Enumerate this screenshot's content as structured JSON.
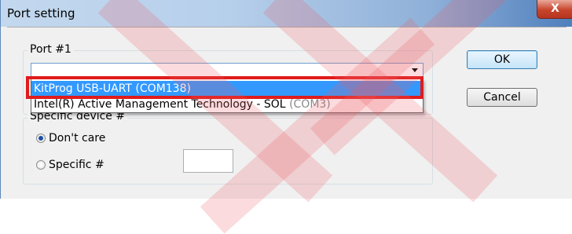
{
  "window": {
    "title": "Port setting",
    "close_glyph": "X"
  },
  "port_group": {
    "legend": "Port #1",
    "combo_value": "",
    "options": [
      {
        "label": "KitProg USB-UART (COM138)",
        "selected": true,
        "extra": ""
      },
      {
        "label": "Intel(R) Active Management Technology - SOL ",
        "selected": false,
        "extra": "(COM3)"
      }
    ]
  },
  "device_group": {
    "legend": "Specific device #",
    "radios": [
      {
        "label": "Don't care",
        "checked": true
      },
      {
        "label": "Specific #",
        "checked": false
      }
    ],
    "specific_value": ""
  },
  "buttons": {
    "ok": "OK",
    "cancel": "Cancel"
  },
  "colors": {
    "highlight": "#e01b1b",
    "selection": "#3399ff",
    "watermark": "#ec5a64"
  }
}
